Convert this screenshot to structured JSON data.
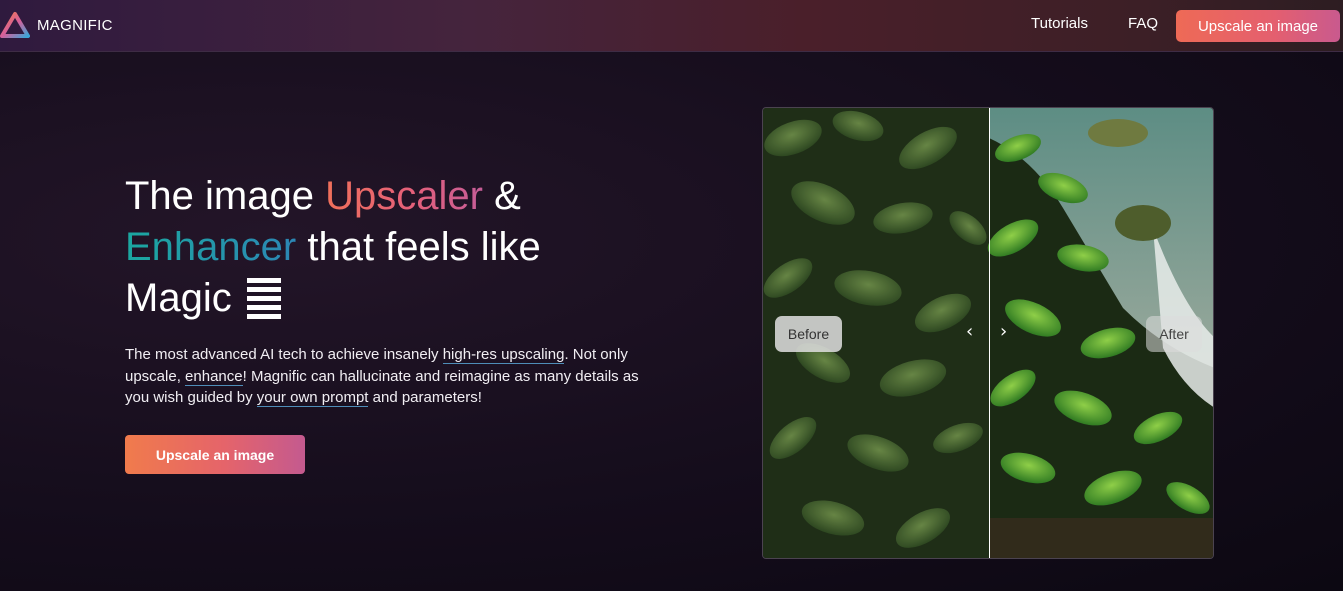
{
  "nav": {
    "brand": "MAGNIFIC",
    "logo_icon": "triangle-logo-icon",
    "links": [
      {
        "label": "Tutorials"
      },
      {
        "label": "FAQ"
      }
    ],
    "cta_label": "Upscale an image"
  },
  "hero": {
    "title": {
      "part1": "The image ",
      "upscaler": "Upscaler",
      "part2": " &",
      "enhancer": "Enhancer",
      "part3": " that feels like",
      "part4": "Magic"
    },
    "description": {
      "t1": "The most advanced AI tech to achieve insanely ",
      "link1": "high-res upscaling",
      "t2": ". Not only upscale, ",
      "link2": "enhance",
      "t3": "! Magnific can hallucinate and reimagine as many details as you wish guided by ",
      "link3": "your own prompt",
      "t4": " and parameters!"
    },
    "cta_label": "Upscale an image"
  },
  "compare": {
    "before_label": "Before",
    "after_label": "After",
    "left_arrow": "‹",
    "right_arrow": "›"
  },
  "colors": {
    "accent_orange": "#f07b4c",
    "accent_pink": "#c45a8f",
    "accent_teal": "#1ba8a0"
  }
}
